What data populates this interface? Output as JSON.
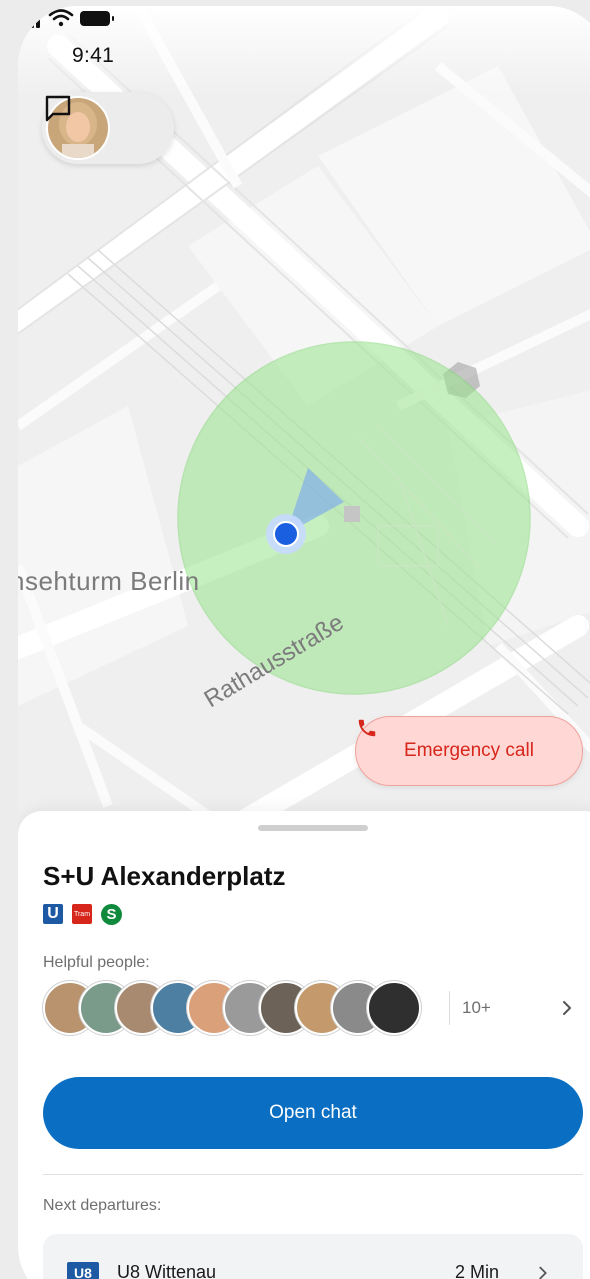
{
  "status_bar": {
    "time": "9:41"
  },
  "map": {
    "landmark_label": "nsehturm Berlin",
    "street_label": "Rathausstraße",
    "zone_color": "#a8ec9e",
    "location_dot_color": "#1a5fe0"
  },
  "emergency": {
    "label": "Emergency call",
    "color": "#d7261b"
  },
  "station": {
    "name": "S+U Alexanderplatz",
    "line_badges": [
      {
        "type": "U",
        "text": "U"
      },
      {
        "type": "tram",
        "text": "Tram"
      },
      {
        "type": "S",
        "text": "S"
      }
    ]
  },
  "helpful_people": {
    "label": "Helpful people:",
    "more_count": "10+",
    "avatar_count": 10
  },
  "open_chat": {
    "label": "Open chat",
    "color": "#0a6fc2"
  },
  "departures": {
    "label": "Next departures:",
    "items": [
      {
        "line_badge": "U8",
        "line": "U8 Wittenau",
        "time": "2 Min"
      }
    ]
  }
}
